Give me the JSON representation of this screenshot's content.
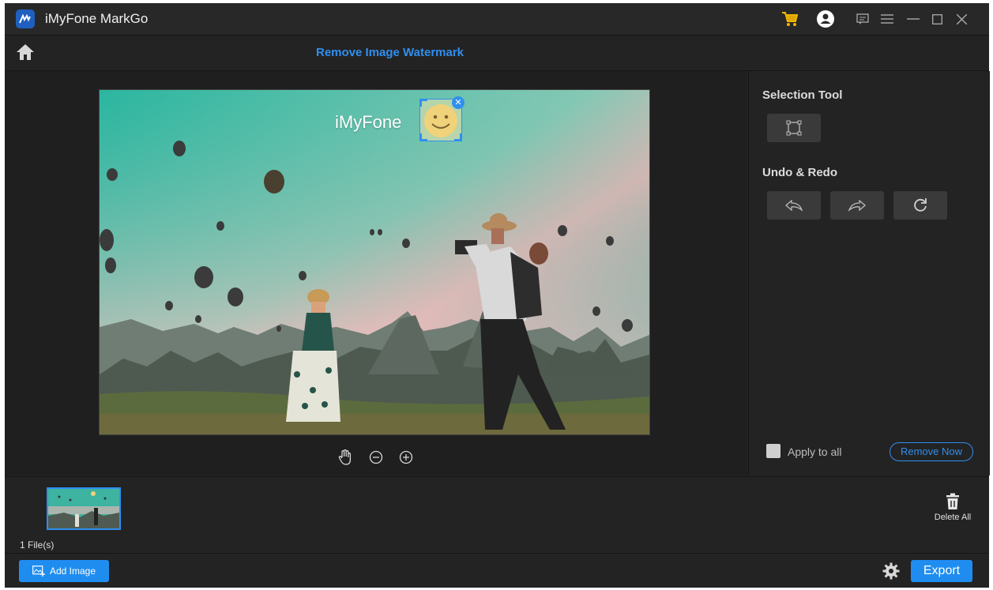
{
  "app": {
    "title": "iMyFone MarkGo"
  },
  "header": {
    "page_title": "Remove Image Watermark"
  },
  "canvas": {
    "watermark_text": "iMyFone"
  },
  "right_panel": {
    "selection_tool_title": "Selection Tool",
    "undo_redo_title": "Undo & Redo",
    "apply_to_all_label": "Apply to all",
    "remove_now_label": "Remove Now"
  },
  "files": {
    "count_label": "1 File(s)",
    "delete_all_label": "Delete All"
  },
  "footer": {
    "add_image_label": "Add Image",
    "export_label": "Export"
  },
  "icons": {
    "logo": "markgo-logo-icon",
    "cart": "cart-icon",
    "account": "account-icon",
    "feedback": "feedback-icon",
    "menu": "menu-icon",
    "minimize": "minimize-icon",
    "maximize": "maximize-icon",
    "close": "close-icon",
    "home": "home-icon",
    "hand": "hand-icon",
    "zoom_out": "zoom-out-icon",
    "zoom_in": "zoom-in-icon",
    "rect_select": "rectangle-select-icon",
    "undo": "undo-icon",
    "redo": "redo-icon",
    "reset": "reset-icon",
    "trash": "trash-icon",
    "settings": "gear-icon"
  },
  "colors": {
    "accent": "#2f8ff0",
    "background": "#232323",
    "cart": "#f2b400"
  }
}
